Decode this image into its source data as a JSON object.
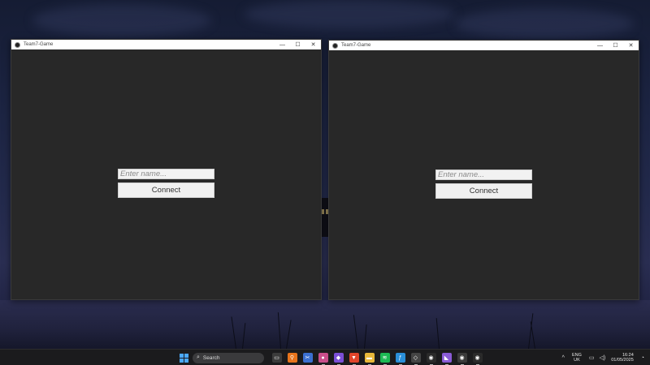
{
  "windows": [
    {
      "title": "Team7-Game",
      "controls": {
        "minimize": "—",
        "maximize": "☐",
        "close": "✕"
      },
      "name_input": {
        "placeholder": "Enter name...",
        "value": ""
      },
      "connect_label": "Connect"
    },
    {
      "title": "Team7-Game",
      "controls": {
        "minimize": "—",
        "maximize": "☐",
        "close": "✕"
      },
      "name_input": {
        "placeholder": "Enter name...",
        "value": ""
      },
      "connect_label": "Connect"
    }
  ],
  "taskbar": {
    "search_label": "Search",
    "search_glyph": "⌕",
    "apps": [
      {
        "name": "file-explorer-icon",
        "glyph": "▭",
        "color": "#3b3b3b"
      },
      {
        "name": "search-app-icon",
        "glyph": "⚲",
        "color": "#e8741c"
      },
      {
        "name": "snipping-tool-icon",
        "glyph": "✂",
        "color": "#3b6fd0"
      },
      {
        "name": "godot-icon",
        "glyph": "●",
        "color": "#c94e8a"
      },
      {
        "name": "obsidian-icon",
        "glyph": "◆",
        "color": "#7b4fd6"
      },
      {
        "name": "brave-icon",
        "glyph": "▼",
        "color": "#e0452a"
      },
      {
        "name": "folder-icon",
        "glyph": "▬",
        "color": "#e8b83a"
      },
      {
        "name": "spotify-icon",
        "glyph": "≋",
        "color": "#1db954"
      },
      {
        "name": "sourcetree-icon",
        "glyph": "ƒ",
        "color": "#2a8fd8"
      },
      {
        "name": "unity-icon",
        "glyph": "◇",
        "color": "#444444"
      },
      {
        "name": "game-app-icon-1",
        "glyph": "◉",
        "color": "#2a2a2a"
      },
      {
        "name": "visual-studio-icon",
        "glyph": "◣",
        "color": "#8a5bd6"
      },
      {
        "name": "game-app-icon-2",
        "glyph": "◉",
        "color": "#3a3a3a"
      },
      {
        "name": "game-app-icon-3",
        "glyph": "◉",
        "color": "#2a2a2a"
      }
    ],
    "tray": {
      "chevron": "^",
      "lang_top": "ENG",
      "lang_bottom": "UK",
      "time": "16:24",
      "date": "01/05/2025"
    }
  }
}
